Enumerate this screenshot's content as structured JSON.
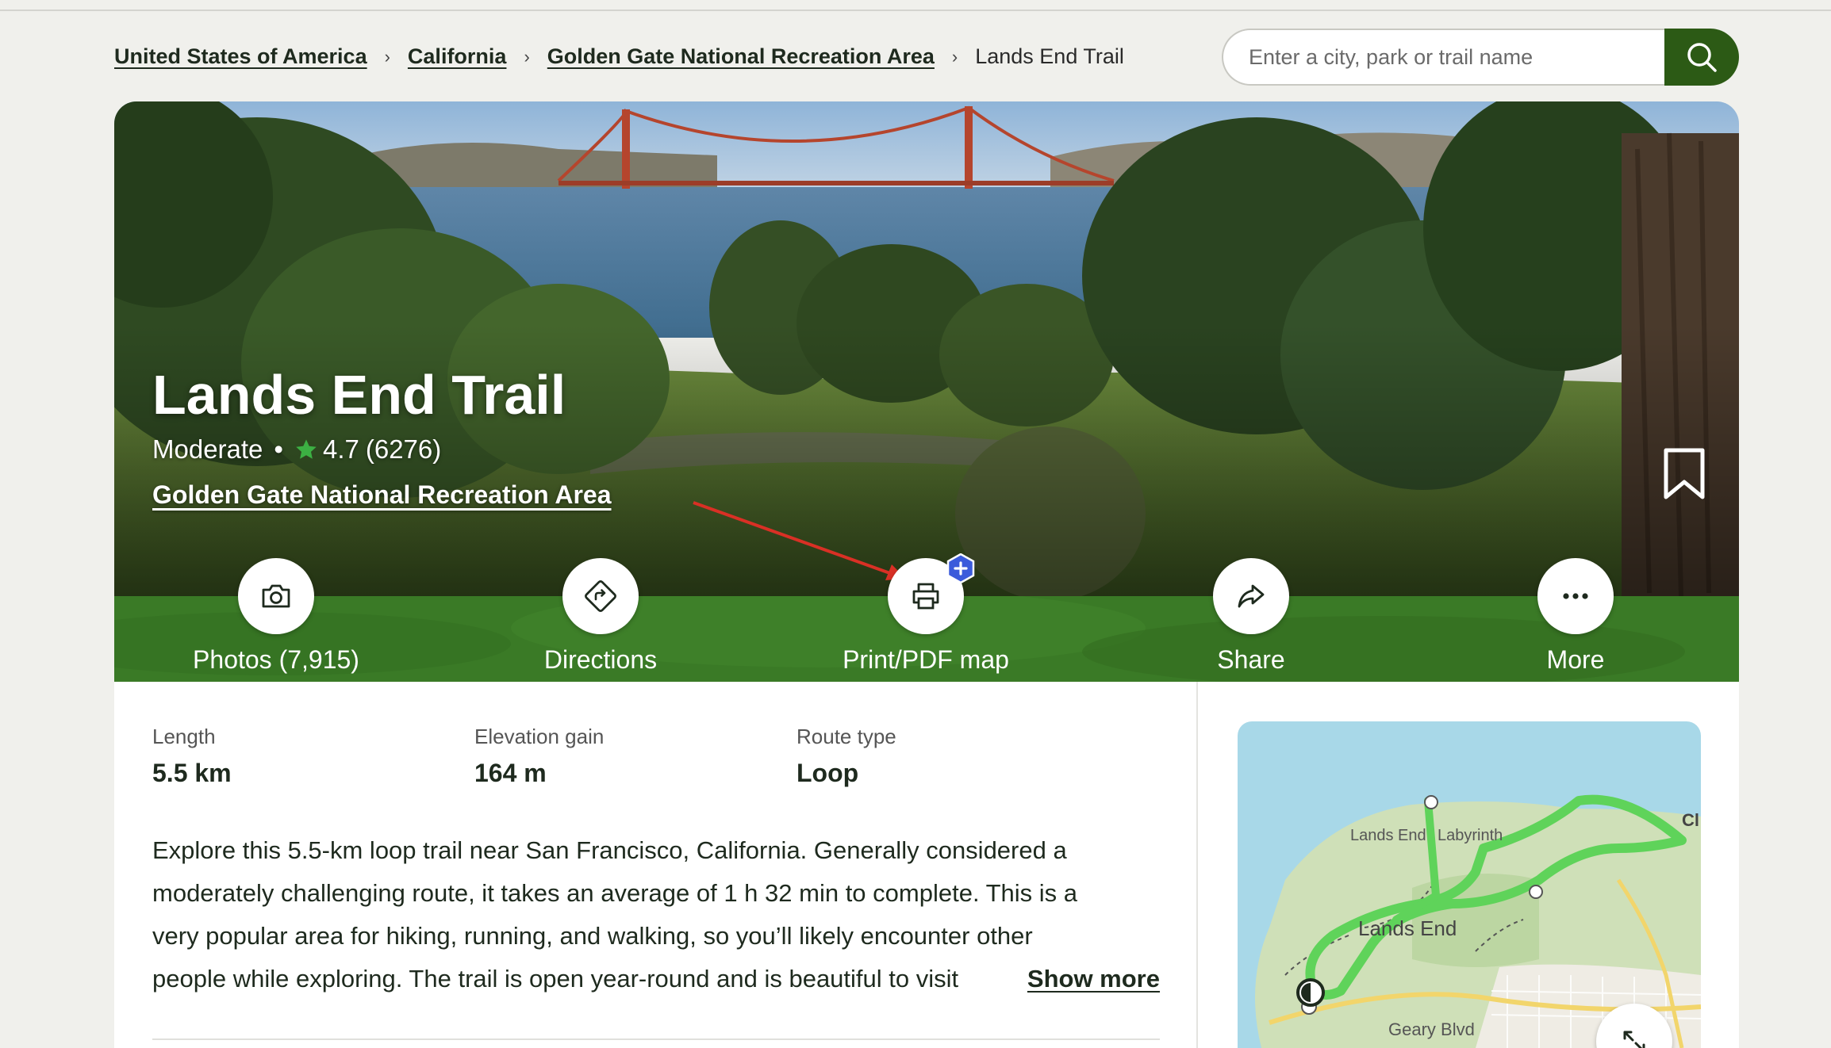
{
  "breadcrumb": {
    "items": [
      {
        "label": "United States of America"
      },
      {
        "label": "California"
      },
      {
        "label": "Golden Gate National Recreation Area"
      }
    ],
    "separator": "›",
    "current": "Lands End Trail"
  },
  "search": {
    "placeholder": "Enter a city, park or trail name",
    "icon": "search-icon"
  },
  "hero": {
    "title": "Lands End Trail",
    "difficulty": "Moderate",
    "separator": "•",
    "rating": "4.7",
    "review_count": "(6276)",
    "park": "Golden Gate National Recreation Area",
    "star_color": "#3cb043",
    "bookmark_icon": "bookmark-icon"
  },
  "actions": [
    {
      "label": "Photos (7,915)",
      "icon": "camera-icon"
    },
    {
      "label": "Directions",
      "icon": "directions-icon"
    },
    {
      "label": "Print/PDF map",
      "icon": "printer-icon",
      "badge": "plus-badge-icon"
    },
    {
      "label": "Share",
      "icon": "share-icon"
    },
    {
      "label": "More",
      "icon": "more-icon"
    }
  ],
  "stats": [
    {
      "label": "Length",
      "value": "5.5 km"
    },
    {
      "label": "Elevation gain",
      "value": "164 m"
    },
    {
      "label": "Route type",
      "value": "Loop"
    }
  ],
  "description": {
    "lines": [
      "Explore this 5.5-km loop trail near San Francisco, California. Generally considered a",
      "moderately challenging route, it takes an average of 1 h 32 min to complete. This is a",
      "very popular area for hiking, running, and walking, so you’ll likely encounter other",
      "people while exploring. The trail is open year-round and is beautiful to visit"
    ],
    "show_more": "Show more"
  },
  "map": {
    "labels": {
      "lands_end_small": "Lands End",
      "labyrinth": "Labyrinth",
      "lands_end_big": "Lands End",
      "geary": "Geary Blvd",
      "edge": "Cl"
    },
    "expand_icon": "expand-icon"
  },
  "colors": {
    "brand_green": "#2c5a15",
    "action_bar": "#3a7a26",
    "trail_green": "#5fd35a",
    "badge_blue": "#3b5bdb",
    "annotation_arrow": "#d93025"
  }
}
